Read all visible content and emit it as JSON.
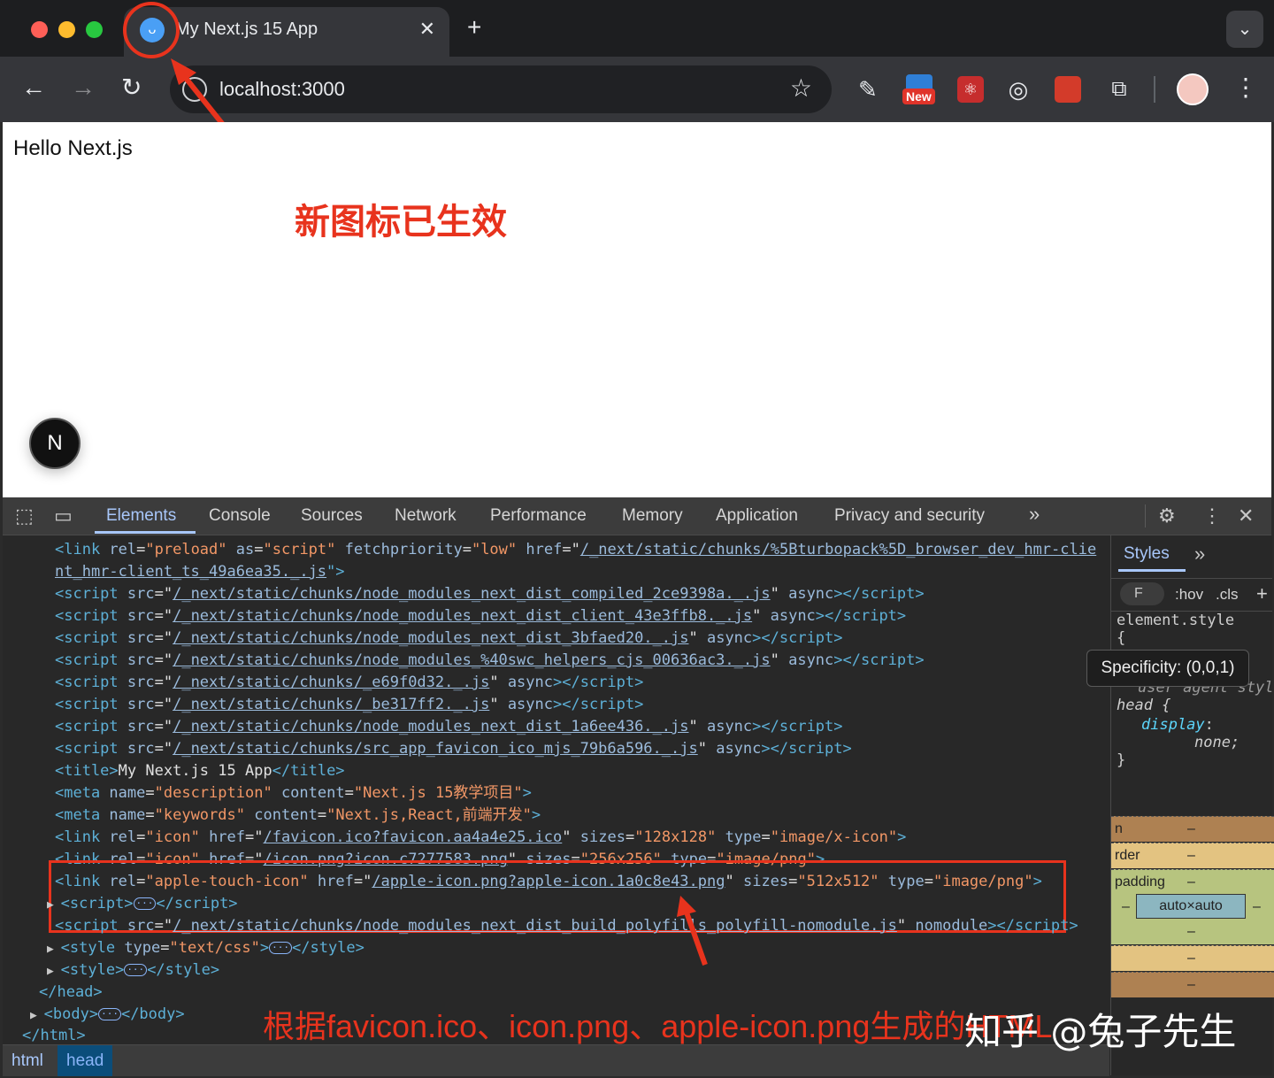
{
  "browser": {
    "tab": {
      "title": "My Next.js 15 App",
      "favicon": "rabbit-icon",
      "close": "✕"
    },
    "new_tab": "+",
    "tab_menu": "⌄",
    "toolbar": {
      "back": "←",
      "forward": "→",
      "reload": "↻",
      "url": "localhost:3000",
      "bookmark": "☆",
      "extensions": [
        "pen-icon",
        "new-extension-icon",
        "react-devtools-icon",
        "target-icon",
        "red-extension-icon",
        "puzzle-icon"
      ],
      "new_badge": "New",
      "menu": "⋮"
    }
  },
  "page": {
    "text": "Hello Next.js",
    "next_badge": "N"
  },
  "annotations": {
    "favicon_note": "新图标已生效",
    "html_note": "根据favicon.ico、icon.png、apple-icon.png生成的HTML",
    "accent_color": "#e8331d"
  },
  "devtools": {
    "tabs": [
      "Elements",
      "Console",
      "Sources",
      "Network",
      "Performance",
      "Memory",
      "Application",
      "Privacy and security"
    ],
    "more_tabs": "»",
    "code_lines": {
      "l1": {
        "tag": "<link ",
        "a1": "rel",
        "v1": "\"preload\"",
        "a2": "as",
        "v2": "\"script\"",
        "a3": "fetchpriority",
        "v3": "\"low\"",
        "a4": "href",
        "u": "/_next/static/chunks/%5Bturbopack%5D_browser_dev_hmr-clie",
        "u2": "nt_hmr-client_ts_49a6ea35._.js",
        "end": "\">"
      },
      "scripts": [
        {
          "src": "/_next/static/chunks/node_modules_next_dist_compiled_2ce9398a._.js"
        },
        {
          "src": "/_next/static/chunks/node_modules_next_dist_client_43e3ffb8._.js"
        },
        {
          "src": "/_next/static/chunks/node_modules_next_dist_3bfaed20._.js"
        },
        {
          "src": "/_next/static/chunks/node_modules_%40swc_helpers_cjs_00636ac3._.js"
        },
        {
          "src": "/_next/static/chunks/_e69f0d32._.js"
        },
        {
          "src": "/_next/static/chunks/_be317ff2._.js"
        },
        {
          "src": "/_next/static/chunks/node_modules_next_dist_1a6ee436._.js"
        },
        {
          "src": "/_next/static/chunks/src_app_favicon_ico_mjs_79b6a596._.js"
        }
      ],
      "title": "My Next.js 15 App",
      "meta_desc": {
        "name": "\"description\"",
        "content": "\"Next.js 15教学项目\""
      },
      "meta_kw": {
        "name": "\"keywords\"",
        "content": "\"Next.js,React,前端开发\""
      },
      "icons": [
        {
          "rel": "\"icon\"",
          "href": "/favicon.ico?favicon.aa4a4e25.ico",
          "sizes": "\"128x128\"",
          "type": "\"image/x-icon\""
        },
        {
          "rel": "\"icon\"",
          "href": "/icon.png?icon.c7277583.png",
          "sizes": "\"256x256\"",
          "type": "\"image/png\""
        },
        {
          "rel": "\"apple-touch-icon\"",
          "href": "/apple-icon.png?apple-icon.1a0c8e43.png",
          "sizes": "\"512x512\"",
          "type": "\"image/png\""
        }
      ],
      "polyfill": "/_next/static/chunks/node_modules_next_dist_build_polyfills_polyfill-nomodule.js",
      "style_type": "\"text/css\"",
      "head_close": "</head>",
      "body": "<body>",
      "body_close": "</body>",
      "html_close": "</html>"
    },
    "breadcrumbs": [
      "html",
      "head"
    ],
    "styles": {
      "tab": "Styles",
      "hov": ":hov",
      "cls": ".cls",
      "element_style": "element.style",
      "open_brace": "{",
      "ua": "user agent styl",
      "selector": "head {",
      "prop": "display",
      "value": "none;",
      "close": "}",
      "tooltip": "Specificity: (0,0,1)"
    },
    "box_model": {
      "border": "rder",
      "padding": "padding",
      "content": "auto×auto",
      "dash": "–",
      "margin_frag": "n"
    }
  },
  "watermark": "知乎 @兔子先生"
}
